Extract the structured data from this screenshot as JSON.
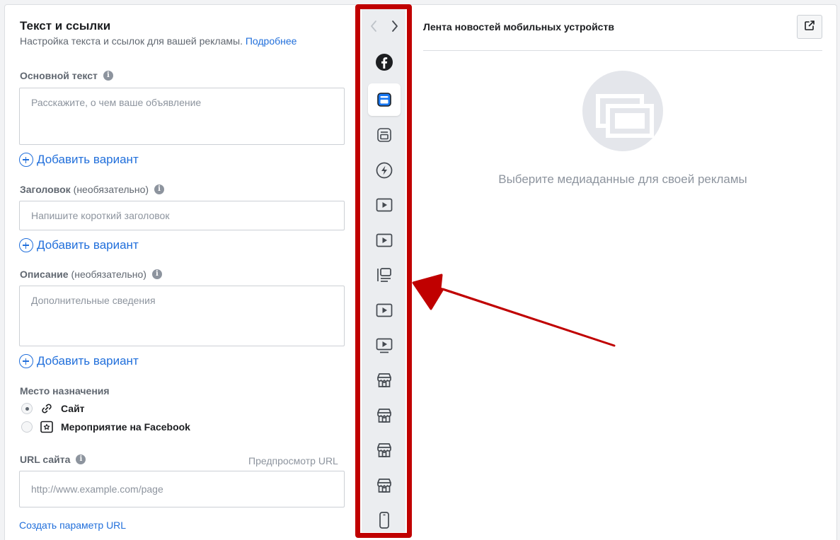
{
  "section": {
    "title": "Текст и ссылки",
    "subtitle": "Настройка текста и ссылок для вашей рекламы.",
    "learn_more": "Подробнее"
  },
  "fields": {
    "primary_text": {
      "label": "Основной текст",
      "placeholder": "Расскажите, о чем ваше объявление"
    },
    "headline": {
      "label": "Заголовок",
      "optional": "(необязательно)",
      "placeholder": "Напишите короткий заголовок"
    },
    "description": {
      "label": "Описание",
      "optional": "(необязательно)",
      "placeholder": "Дополнительные сведения"
    },
    "url": {
      "label": "URL сайта",
      "placeholder": "http://www.example.com/page",
      "preview": "Предпросмотр URL"
    }
  },
  "add_variant": "Добавить вариант",
  "destination": {
    "label": "Место назначения",
    "options": [
      {
        "label": "Сайт",
        "icon": "link-icon",
        "selected": true
      },
      {
        "label": "Мероприятие на Facebook",
        "icon": "event-star-icon",
        "selected": false
      }
    ]
  },
  "create_url_param": "Создать параметр URL",
  "placements": {
    "items": [
      {
        "icon": "facebook-icon",
        "active": false
      },
      {
        "icon": "feed-icon",
        "active": true
      },
      {
        "icon": "feed-alt-icon",
        "active": false
      },
      {
        "icon": "instant-article-icon",
        "active": false
      },
      {
        "icon": "video-icon",
        "active": false
      },
      {
        "icon": "video-icon",
        "active": false
      },
      {
        "icon": "right-column-icon",
        "active": false
      },
      {
        "icon": "video-icon",
        "active": false
      },
      {
        "icon": "video-feed-icon",
        "active": false
      },
      {
        "icon": "marketplace-icon",
        "active": false
      },
      {
        "icon": "marketplace-icon",
        "active": false
      },
      {
        "icon": "marketplace-icon",
        "active": false
      },
      {
        "icon": "marketplace-icon",
        "active": false
      },
      {
        "icon": "mobile-icon",
        "active": false
      }
    ]
  },
  "preview": {
    "title": "Лента новостей мобильных устройств",
    "hint": "Выберите медиаданные для своей рекламы"
  },
  "colors": {
    "accent": "#216fdb",
    "annotation": "#c00000",
    "active_icon": "#1877f2"
  }
}
